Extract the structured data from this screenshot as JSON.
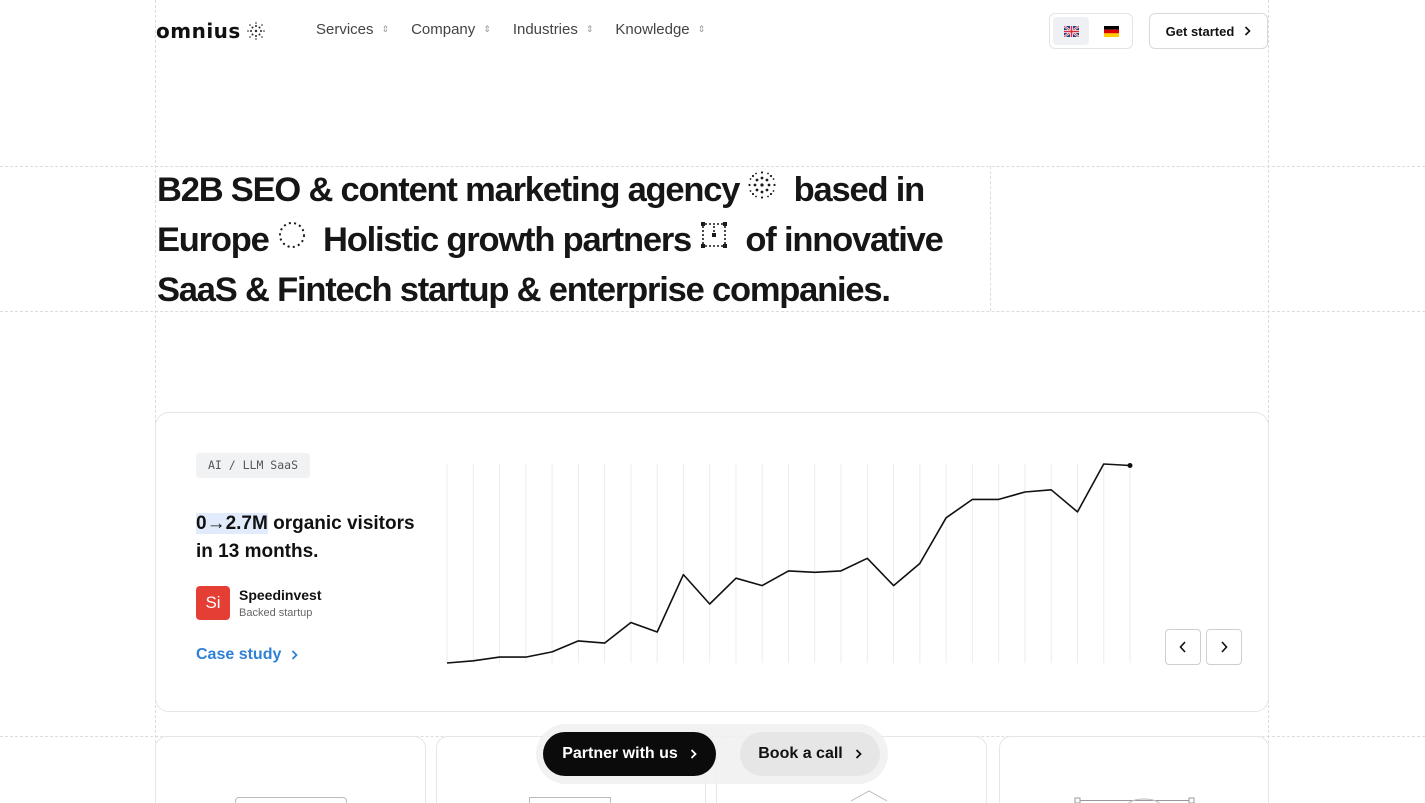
{
  "header": {
    "logo_text": "omnius",
    "nav": [
      {
        "label": "Services"
      },
      {
        "label": "Company"
      },
      {
        "label": "Industries"
      },
      {
        "label": "Knowledge"
      }
    ],
    "languages": [
      {
        "code": "en",
        "icon": "uk-flag-icon",
        "active": true
      },
      {
        "code": "de",
        "icon": "germany-flag-icon",
        "active": false
      }
    ],
    "cta_label": "Get started"
  },
  "hero": {
    "part1": "B2B SEO & content marketing agency",
    "part2": "based in Europe",
    "part3": "Holistic growth partners",
    "part4": "of innovative SaaS & Fintech startup & enterprise companies."
  },
  "case": {
    "tag": "AI / LLM SaaS",
    "stat_highlight": "0→2.7M",
    "stat_rest": " organic visitors in 13 months.",
    "company_initials": "Si",
    "company_name": "Speedinvest",
    "company_sub": "Backed startup",
    "link_label": "Case study",
    "prev_icon": "chevron-left-icon",
    "next_icon": "chevron-right-icon"
  },
  "cta": {
    "primary": "Partner with us",
    "secondary": "Book a call"
  },
  "colors": {
    "accent_link": "#2f80d6",
    "highlight": "#e2ebfb",
    "company_logo": "#e53e34",
    "primary_button": "#0b0b0b"
  },
  "chart_data": {
    "type": "line",
    "title": "",
    "xlabel": "",
    "ylabel": "",
    "grid": true,
    "ylim": [
      0,
      2.7
    ],
    "series": [
      {
        "values": [
          0.0,
          0.03,
          0.08,
          0.08,
          0.15,
          0.3,
          0.27,
          0.55,
          0.42,
          1.2,
          0.8,
          1.15,
          1.05,
          1.25,
          1.23,
          1.25,
          1.42,
          1.05,
          1.35,
          1.97,
          2.22,
          2.22,
          2.32,
          2.35,
          2.05,
          2.7,
          2.68
        ]
      }
    ]
  }
}
